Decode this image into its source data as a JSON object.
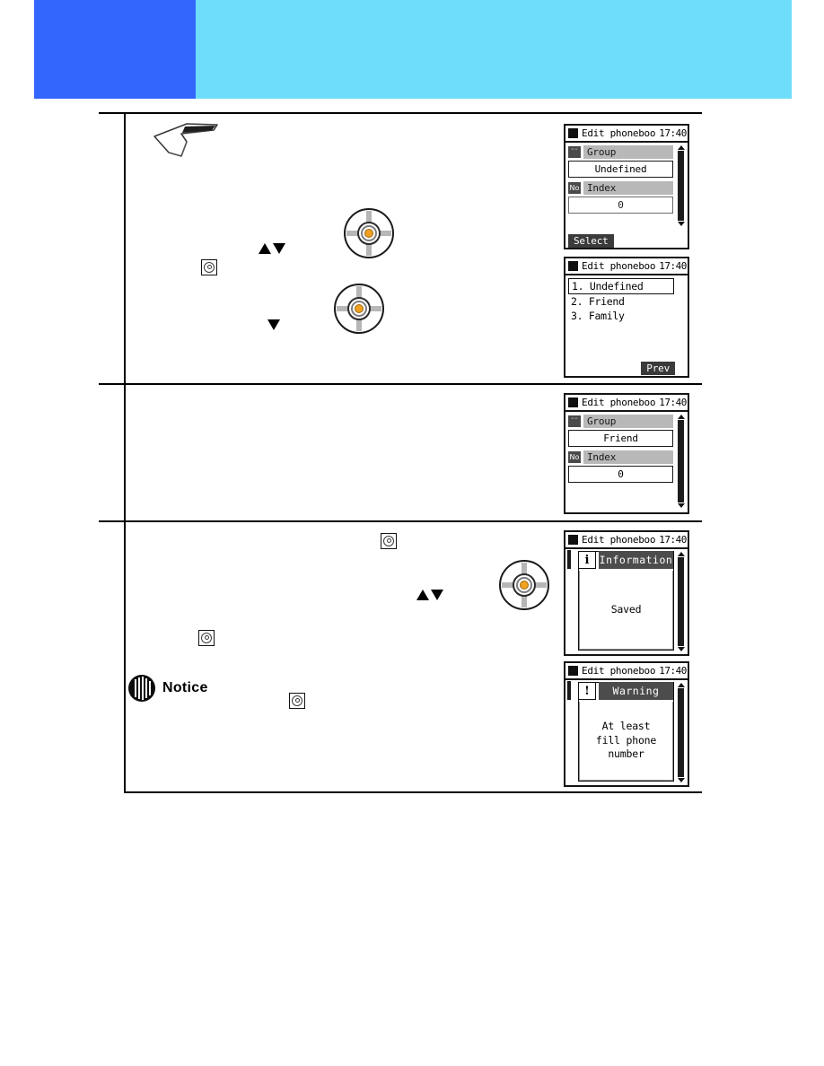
{
  "header": {
    "primary_color": "#3366fd",
    "secondary_color": "#6eddfb"
  },
  "notice": {
    "label": "Notice",
    "icon": "speaker-notice-icon"
  },
  "icons": {
    "enter_key": "enter-key-icon",
    "jog_wheel": "jog-wheel-icon",
    "arrow_up": "triangle-up-icon",
    "arrow_down": "triangle-down-icon",
    "pointer": "hand-pointer-icon"
  },
  "screens": [
    {
      "id": "edit-phonebook-group-undefined",
      "title": "Edit phoneboo",
      "time": "17:40",
      "fields": [
        {
          "icon_text": "¨¨",
          "icon_name": "group-icon",
          "label": "Group",
          "value": "Undefined"
        },
        {
          "icon_text": "No",
          "icon_name": "index-number-icon",
          "label": "Index",
          "value": "0"
        }
      ],
      "softkey": "Select",
      "softkey_align": "left"
    },
    {
      "id": "group-selection-list",
      "title": "Edit phoneboo",
      "time": "17:40",
      "list": [
        {
          "text": "1. Undefined",
          "selected": true
        },
        {
          "text": "2. Friend",
          "selected": false
        },
        {
          "text": "3. Family",
          "selected": false
        }
      ],
      "softkey": "Prev",
      "softkey_align": "right"
    },
    {
      "id": "edit-phonebook-group-friend",
      "title": "Edit phoneboo",
      "time": "17:40",
      "fields": [
        {
          "icon_text": "¨¨",
          "icon_name": "group-icon",
          "label": "Group",
          "value": "Friend"
        },
        {
          "icon_text": "No",
          "icon_name": "index-number-icon",
          "label": "Index",
          "value": "0"
        }
      ],
      "softkey": "",
      "softkey_align": "left"
    },
    {
      "id": "information-saved-dialog",
      "title": "Edit phoneboo",
      "time": "17:40",
      "dialog": {
        "badge": "i",
        "badge_name": "information-icon",
        "heading": "Information",
        "message_lines": [
          "Saved"
        ]
      }
    },
    {
      "id": "warning-phone-number-dialog",
      "title": "Edit phoneboo",
      "time": "17:40",
      "dialog": {
        "badge": "!",
        "badge_name": "warning-icon",
        "heading": "Warning",
        "message_lines": [
          "At least",
          "fill phone number"
        ]
      }
    }
  ]
}
